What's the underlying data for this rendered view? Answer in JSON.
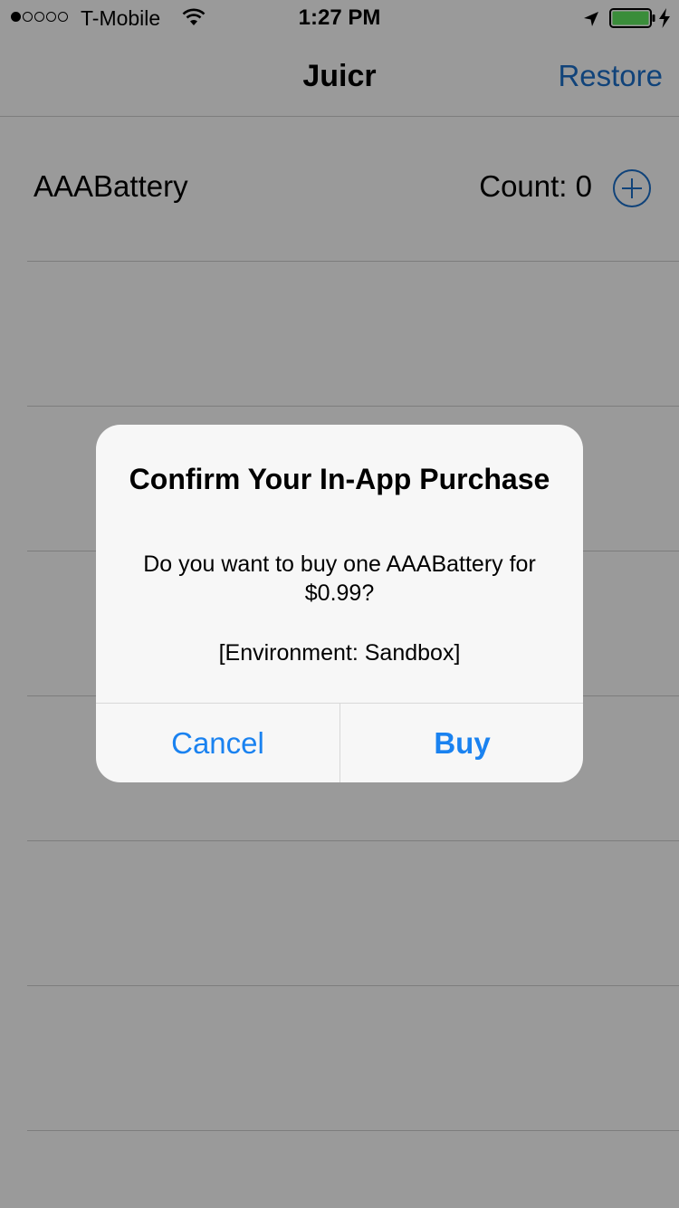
{
  "status_bar": {
    "carrier": "T-Mobile",
    "time": "1:27 PM",
    "signal_bars_filled": 1,
    "signal_bars_total": 5,
    "icons": [
      "wifi-icon",
      "location-icon",
      "battery-icon",
      "charging-bolt-icon"
    ]
  },
  "nav": {
    "title": "Juicr",
    "restore_label": "Restore"
  },
  "list": {
    "items": [
      {
        "name": "AAABattery",
        "count_label": "Count: 0",
        "action_icon": "add-circle-icon"
      }
    ]
  },
  "alert": {
    "title": "Confirm Your In-App Purchase",
    "message": "Do you want to buy one AAABattery for $0.99?",
    "environment": "[Environment: Sandbox]",
    "cancel_label": "Cancel",
    "buy_label": "Buy"
  },
  "colors": {
    "overlay_background": "#9a9a9a",
    "nav_tint_dimmed": "#10437a",
    "alert_button_blue": "#1a82f0",
    "battery_green": "#3a8d3a"
  }
}
